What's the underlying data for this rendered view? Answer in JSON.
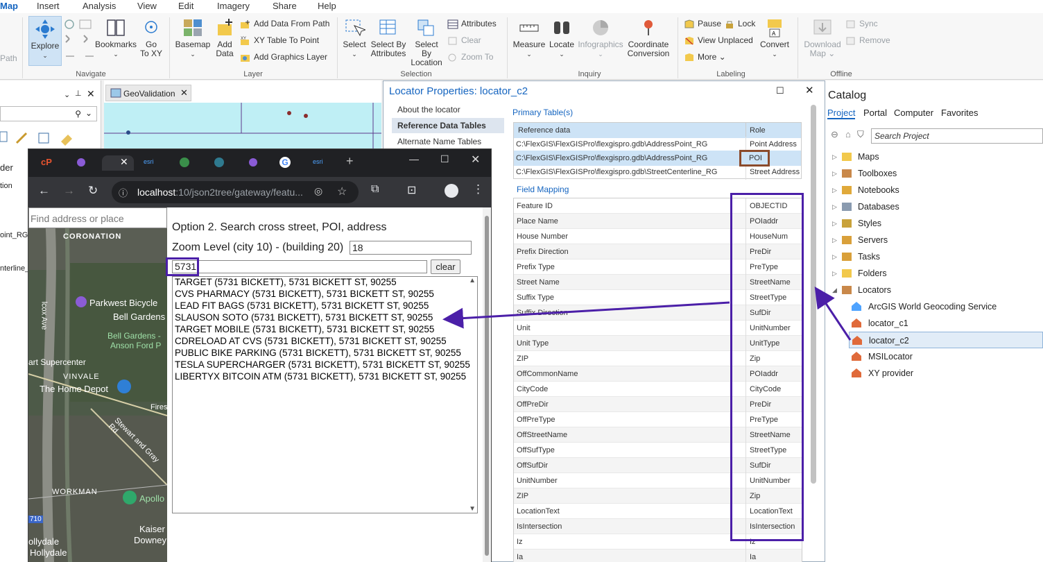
{
  "ribbon": {
    "tabs": [
      "Map",
      "Insert",
      "Analysis",
      "View",
      "Edit",
      "Imagery",
      "Share",
      "Help"
    ],
    "path_label": "Path",
    "navigate": {
      "explore": "Explore",
      "bookmarks": "Bookmarks",
      "goto1": "Go",
      "goto2": "To XY",
      "group": "Navigate"
    },
    "layer": {
      "basemap": "Basemap",
      "add_data1": "Add",
      "add_data2": "Data",
      "add_from_path": "Add Data From Path",
      "xy_table": "XY Table To Point",
      "add_graphics": "Add Graphics Layer",
      "group": "Layer"
    },
    "selection": {
      "select": "Select",
      "by_attr1": "Select By",
      "by_attr2": "Attributes",
      "by_loc1": "Select By",
      "by_loc2": "Location",
      "attributes": "Attributes",
      "clear": "Clear",
      "zoom_to": "Zoom To",
      "group": "Selection"
    },
    "inquiry": {
      "measure": "Measure",
      "locate": "Locate",
      "infographics": "Infographics",
      "coord1": "Coordinate",
      "coord2": "Conversion",
      "group": "Inquiry"
    },
    "labeling": {
      "pause": "Pause",
      "lock": "Lock",
      "view_unplaced": "View Unplaced",
      "more": "More",
      "convert": "Convert",
      "group": "Labeling"
    },
    "offline": {
      "download1": "Download",
      "download2": "Map",
      "sync": "Sync",
      "remove": "Remove",
      "group": "Offline"
    }
  },
  "leftpane": {
    "items": [
      "der",
      "tion",
      "oint_RG",
      "nterline_"
    ]
  },
  "mapview": {
    "tab": "GeoValidation"
  },
  "dialog": {
    "title": "Locator Properties: locator_c2",
    "nav": [
      "About the locator",
      "Reference Data Tables",
      "Alternate Name Tables"
    ],
    "primary_label": "Primary Table(s)",
    "ref_headers": [
      "Reference data",
      "Role"
    ],
    "ref_rows": [
      {
        "data": "C:\\FlexGIS\\FlexGISPro\\flexgispro.gdb\\AddressPoint_RG",
        "role": "Point Address"
      },
      {
        "data": "C:\\FlexGIS\\FlexGISPro\\flexgispro.gdb\\AddressPoint_RG",
        "role": "POI"
      },
      {
        "data": "C:\\FlexGIS\\FlexGISPro\\flexgispro.gdb\\StreetCenterline_RG",
        "role": "Street Address"
      }
    ],
    "field_mapping_label": "Field Mapping",
    "fields": [
      [
        "Feature ID",
        "OBJECTID"
      ],
      [
        "Place Name",
        "POIaddr"
      ],
      [
        "House Number",
        "HouseNum"
      ],
      [
        "Prefix Direction",
        "PreDir"
      ],
      [
        "Prefix Type",
        "PreType"
      ],
      [
        "Street Name",
        "StreetName"
      ],
      [
        "Suffix Type",
        "StreetType"
      ],
      [
        "Suffix Direction",
        "SufDir"
      ],
      [
        "Unit",
        "UnitNumber"
      ],
      [
        "Unit Type",
        "UnitType"
      ],
      [
        "ZIP",
        "Zip"
      ],
      [
        "OffCommonName",
        "POIaddr"
      ],
      [
        "CityCode",
        "CityCode"
      ],
      [
        "OffPreDir",
        "PreDir"
      ],
      [
        "OffPreType",
        "PreType"
      ],
      [
        "OffStreetName",
        "StreetName"
      ],
      [
        "OffSufType",
        "StreetType"
      ],
      [
        "OffSufDir",
        "SufDir"
      ],
      [
        "UnitNumber",
        "UnitNumber"
      ],
      [
        "ZIP",
        "Zip"
      ],
      [
        "LocationText",
        "LocationText"
      ],
      [
        "IsIntersection",
        "IsIntersection"
      ],
      [
        "Iz",
        "Iz"
      ],
      [
        "Ia",
        "Ia"
      ]
    ]
  },
  "browser": {
    "url_host": "localhost",
    "url_rest": ":10/json2tree/gateway/featu...",
    "map_search_placeholder": "Find address or place",
    "option_heading": "Option 2. Search cross street, POI, address",
    "zoom_label": "Zoom Level (city 10) - (building 20)",
    "zoom_value": "18",
    "search_value": "5731",
    "clear_label": "clear",
    "results": [
      "TARGET (5731 BICKETT), 5731 BICKETT ST, 90255",
      "CVS PHARMACY (5731 BICKETT), 5731 BICKETT ST, 90255",
      "LEAD FIT BAGS (5731 BICKETT), 5731 BICKETT ST, 90255",
      "SLAUSON SOTO (5731 BICKETT), 5731 BICKETT ST, 90255",
      "TARGET MOBILE (5731 BICKETT), 5731 BICKETT ST, 90255",
      "CDRELOAD AT CVS (5731 BICKETT), 5731 BICKETT ST, 90255",
      "PUBLIC BIKE PARKING (5731 BICKETT), 5731 BICKETT ST, 90255",
      "TESLA SUPERCHARGER (5731 BICKETT), 5731 BICKETT ST, 90255",
      "LIBERTYX BITCOIN ATM (5731 BICKETT), 5731 BICKETT ST, 90255"
    ],
    "map_labels": [
      "CORONATION",
      "Parkwest Bicycle",
      "Bell Gardens",
      "Bell Gardens -",
      "Anson Ford P",
      "art Supercenter",
      "VINVALE",
      "The Home Depot",
      "Fires",
      "Stewart and Gray Rd",
      "WORKMAN",
      "Apollo",
      "Kaiser",
      "Downey",
      "ollydale",
      "Hollydale",
      "lcox Ave",
      "710"
    ]
  },
  "catalog": {
    "title": "Catalog",
    "tabs": [
      "Project",
      "Portal",
      "Computer",
      "Favorites"
    ],
    "search_placeholder": "Search Project",
    "items": [
      "Maps",
      "Toolboxes",
      "Notebooks",
      "Databases",
      "Styles",
      "Servers",
      "Tasks",
      "Folders",
      "Locators"
    ],
    "locators": [
      "ArcGIS World Geocoding Service",
      "locator_c1",
      "locator_c2",
      "MSILocator",
      "XY provider"
    ]
  },
  "colors": {
    "accent": "#1565c0",
    "annotation": "#4b1fa8",
    "poi_box": "#8b4a2b"
  }
}
